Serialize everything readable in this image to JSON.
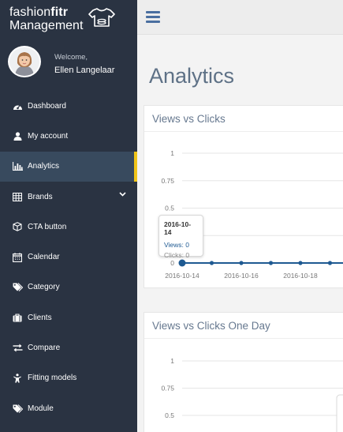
{
  "brand": {
    "name_regular": "fashion",
    "name_bold": "fitr",
    "subtitle": "Management"
  },
  "user": {
    "welcome": "Welcome,",
    "name": "Ellen Langelaar"
  },
  "sidebar": {
    "items": [
      {
        "label": "Dashboard",
        "icon": "dashboard-icon"
      },
      {
        "label": "My account",
        "icon": "user-icon"
      },
      {
        "label": "Analytics",
        "icon": "bar-chart-icon",
        "active": true
      },
      {
        "label": "Brands",
        "icon": "table-icon",
        "has_submenu": true
      },
      {
        "label": "CTA button",
        "icon": "cube-icon"
      },
      {
        "label": "Calendar",
        "icon": "calendar-icon"
      },
      {
        "label": "Category",
        "icon": "tags-icon"
      },
      {
        "label": "Clients",
        "icon": "briefcase-icon"
      },
      {
        "label": "Compare",
        "icon": "exchange-icon"
      },
      {
        "label": "Fitting models",
        "icon": "child-icon"
      },
      {
        "label": "Module",
        "icon": "tags-icon"
      }
    ]
  },
  "main": {
    "title": "Analytics"
  },
  "colors": {
    "sidebar_bg": "#2a3342",
    "active_bg": "#384a5e",
    "accent": "#f0c419",
    "line": "#1f5a92"
  },
  "chart_data": [
    {
      "type": "line",
      "title": "Views vs Clicks",
      "x": [
        "2016-10-14",
        "2016-10-15",
        "2016-10-16",
        "2016-10-17",
        "2016-10-18",
        "2016-10-19"
      ],
      "x_tick_labels": [
        "2016-10-14",
        "2016-10-16",
        "2016-10-18"
      ],
      "y_ticks": [
        "0",
        "0.25",
        "0.5",
        "0.75",
        "1"
      ],
      "ylim": [
        0,
        1
      ],
      "series": [
        {
          "name": "Views",
          "values": [
            0,
            0,
            0,
            0,
            0,
            0
          ]
        },
        {
          "name": "Clicks",
          "values": [
            0,
            0,
            0,
            0,
            0,
            0
          ]
        }
      ],
      "tooltip": {
        "date": "2016-10-14",
        "views_label": "Views",
        "views": "0",
        "clicks_label": "Clicks",
        "clicks": "0"
      }
    },
    {
      "type": "line",
      "title": "Views vs Clicks One Day",
      "y_ticks": [
        "0.5",
        "0.75",
        "1"
      ],
      "ylim": [
        0,
        1
      ]
    }
  ]
}
